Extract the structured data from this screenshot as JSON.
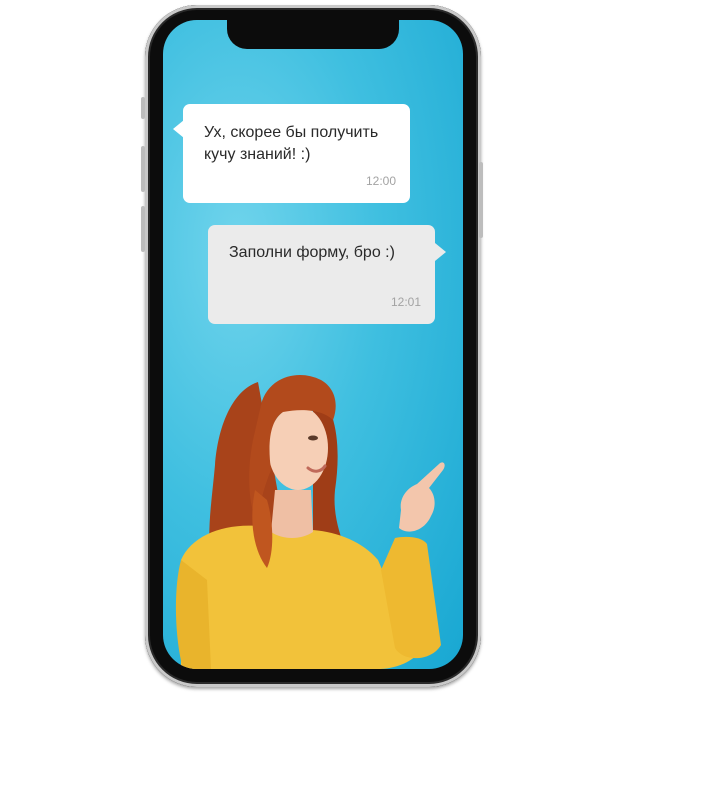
{
  "chat": {
    "messages": [
      {
        "text": "Ух, скорее бы получить\nкучу знаний! :)",
        "time": "12:00"
      },
      {
        "text": "Заполни форму, бро :)",
        "time": "12:01"
      }
    ]
  },
  "colors": {
    "screen_background": "#3fbfe0",
    "incoming_bubble": "#ffffff",
    "outgoing_bubble": "#ebebeb",
    "sweater": "#f2c23a",
    "hair": "#b24a1c"
  },
  "image": {
    "subject": "woman-pointing-up-icon"
  }
}
